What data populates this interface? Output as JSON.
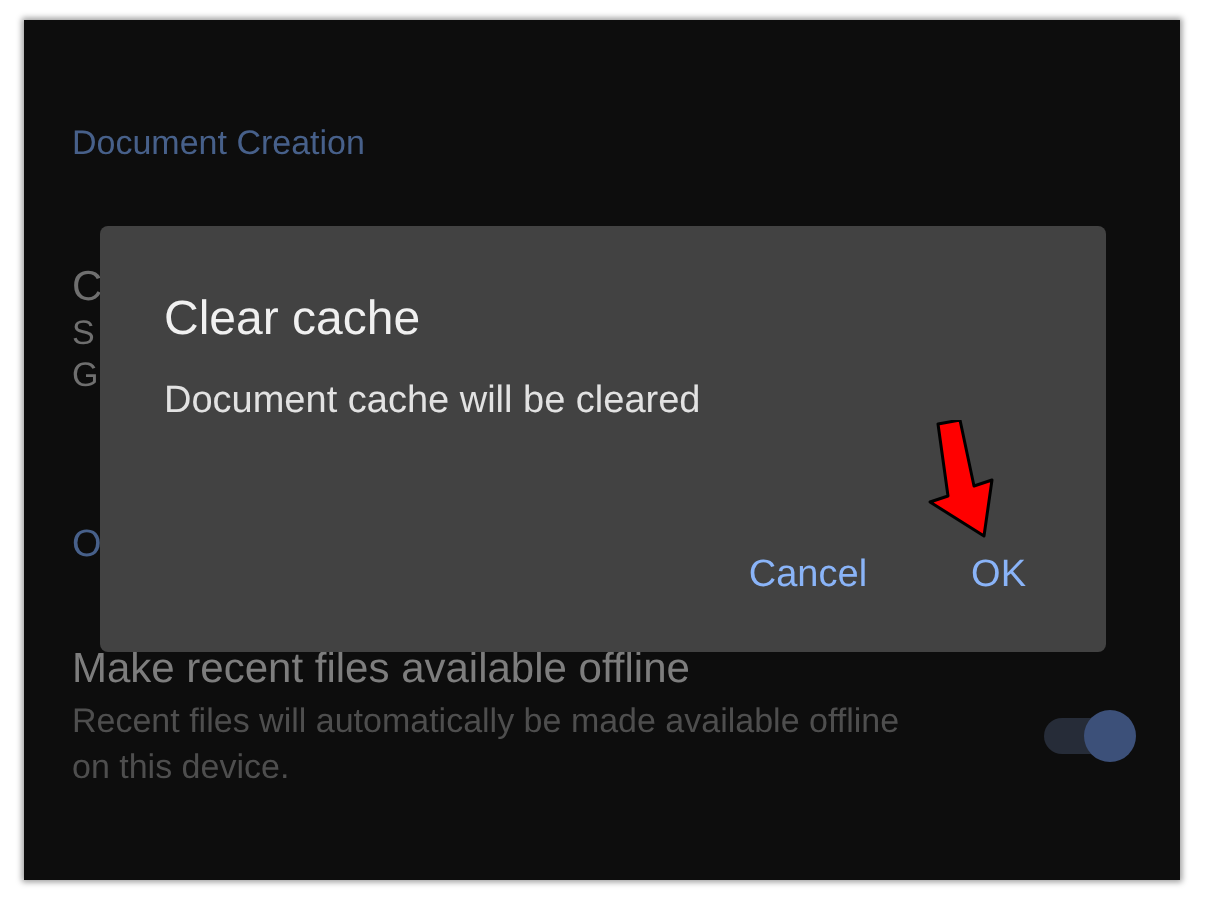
{
  "settings": {
    "section_header": "Document Creation",
    "fragments": [
      {
        "kind": "title",
        "text": "C"
      },
      {
        "kind": "subtitle",
        "text": "S"
      },
      {
        "kind": "subtitle",
        "text": "G"
      },
      {
        "kind": "header",
        "text": "O"
      }
    ],
    "offline_setting": {
      "title": "Make recent files available offline",
      "description": "Recent files will automatically be made available offline on this device.",
      "on": true
    }
  },
  "dialog": {
    "title": "Clear cache",
    "message": "Document cache will be cleared",
    "buttons": [
      "Cancel",
      "OK"
    ]
  },
  "annotation": {
    "kind": "arrow"
  }
}
